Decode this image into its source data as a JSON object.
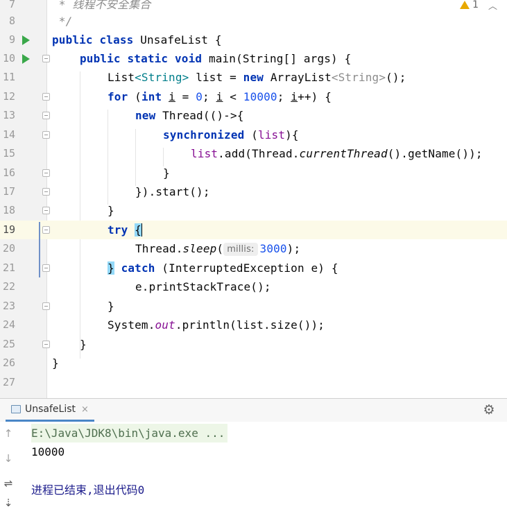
{
  "editor": {
    "lines": [
      {
        "num": "7"
      },
      {
        "num": "8"
      },
      {
        "num": "9"
      },
      {
        "num": "10"
      },
      {
        "num": "11"
      },
      {
        "num": "12"
      },
      {
        "num": "13"
      },
      {
        "num": "14"
      },
      {
        "num": "15"
      },
      {
        "num": "16"
      },
      {
        "num": "17"
      },
      {
        "num": "18"
      },
      {
        "num": "19"
      },
      {
        "num": "20"
      },
      {
        "num": "21"
      },
      {
        "num": "22"
      },
      {
        "num": "23"
      },
      {
        "num": "24"
      },
      {
        "num": "25"
      },
      {
        "num": "26"
      },
      {
        "num": "27"
      }
    ],
    "tokens": {
      "l7_comment": " * 线程不安全集合",
      "l8_comment": " */",
      "kw_public": "public",
      "kw_class": "class",
      "class_name": "UnsafeList {",
      "kw_static": "static",
      "kw_void": "void",
      "main_sig": "main(String[] args) {",
      "l11_a": "List",
      "l11_gen1": "<String>",
      "l11_b": " list = ",
      "kw_new": "new",
      "l11_c": " ArrayList",
      "l11_gen2": "<String>",
      "l11_d": "();",
      "kw_for": "for",
      "kw_int": "int",
      "l12_open": " (",
      "var_i": "i",
      "l12_eq": " = ",
      "num_0": "0",
      "l12_semi1": "; ",
      "l12_lt": " < ",
      "num_10000": "10000",
      "l12_semi2": "; ",
      "l12_inc": "++) {",
      "l13_thread": " Thread(()->{",
      "kw_synchronized": "synchronized",
      "l14_open": " (",
      "field_list": "list",
      "l14_close": "){",
      "l15_list": "list",
      "l15_add": ".add(Thread.",
      "l15_cur": "currentThread",
      "l15_rest": "().getName());",
      "l16": "}",
      "l17": "}).start();",
      "l18": "}",
      "kw_try": "try",
      "l19_brace": "{",
      "l20_a": "Thread.",
      "l20_sleep": "sleep",
      "l20_paren": "(",
      "hint_millis": "millis:",
      "num_3000": "3000",
      "l20_end": ");",
      "l21_brace": "}",
      "kw_catch": "catch",
      "l21_rest": " (InterruptedException e) {",
      "l22": "e.printStackTrace();",
      "l23": "}",
      "l24_a": "System.",
      "l24_out": "out",
      "l24_b": ".println(list.size());",
      "l25": "}",
      "l26": "}"
    },
    "warnings": {
      "count": "1"
    }
  },
  "run_panel": {
    "tab_label": "UnsafeList",
    "tab_close": "×",
    "gear": "⚙",
    "toolbar": {
      "up": "↑",
      "down": "↓",
      "wrap": "⇌",
      "sort": "⇣"
    },
    "console": {
      "command": "E:\\Java\\JDK8\\bin\\java.exe ...",
      "output": "10000",
      "exit_message": "进程已结束,退出代码0"
    }
  },
  "colors": {
    "keyword": "#0033b3",
    "number": "#1750eb",
    "field": "#871094",
    "run_icon": "#3aa84a",
    "current_line": "#fcfae8"
  }
}
